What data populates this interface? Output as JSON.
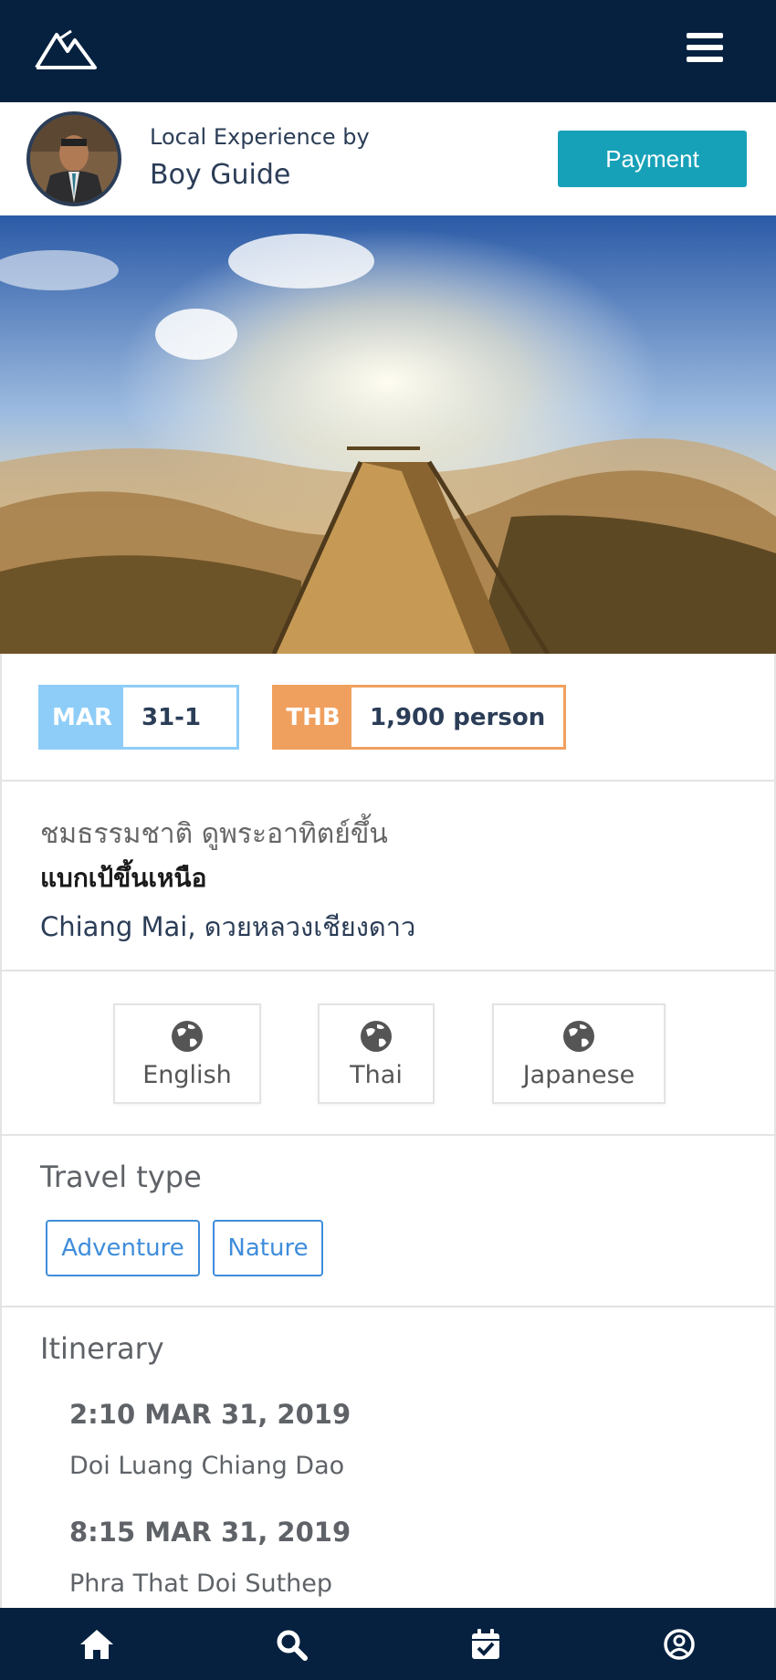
{
  "header": {
    "logo_icon": "mountain-logo-icon",
    "menu_icon": "hamburger-menu-icon"
  },
  "host": {
    "subtitle": "Local Experience by",
    "name": "Boy Guide",
    "payment_label": "Payment"
  },
  "hero": {
    "image": "mountain-walkway-sunrise-photo"
  },
  "chips": {
    "date": {
      "key": "MAR",
      "value": "31-1",
      "key_color": "#8ecdf7"
    },
    "price": {
      "key": "THB",
      "value": "1,900 person",
      "key_color": "#f0a05e"
    }
  },
  "trip": {
    "title": "ชมธรรมชาติ ดูพระอาทิตย์ขึ้น",
    "subtitle": "แบกเป้ขึ้นเหนือ",
    "location": "Chiang Mai, ดวยหลวงเชียงดาว"
  },
  "languages": [
    "English",
    "Thai",
    "Japanese"
  ],
  "travel_type": {
    "heading": "Travel type",
    "tags": [
      "Adventure",
      "Nature"
    ]
  },
  "itinerary": {
    "heading": "Itinerary",
    "items": [
      {
        "time": "2:10 MAR 31, 2019",
        "place": "Doi Luang Chiang Dao"
      },
      {
        "time": "8:15 MAR 31, 2019",
        "place": "Phra That Doi Suthep"
      }
    ]
  },
  "bottom_nav": [
    "home-icon",
    "search-icon",
    "calendar-check-icon",
    "user-circle-icon"
  ],
  "colors": {
    "navy": "#05213f",
    "teal": "#17a1b8",
    "tag_blue": "#3f8ddb"
  }
}
